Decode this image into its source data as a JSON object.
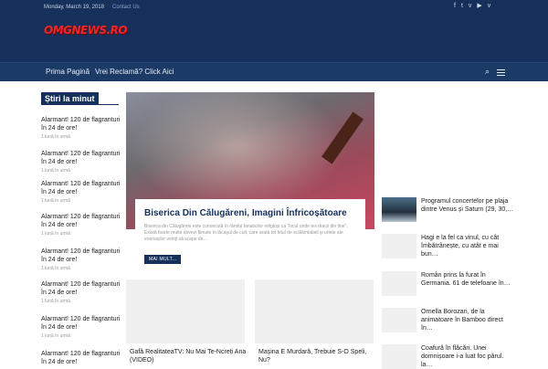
{
  "topbar": {
    "date": "Monday, March 19, 2018",
    "contact": "Contact Us",
    "social_icons": [
      "facebook-icon",
      "twitter-icon",
      "vk-icon",
      "youtube-icon",
      "vimeo-icon"
    ]
  },
  "logo": {
    "text": "OMGNEWS.RO"
  },
  "nav": {
    "items": [
      "Prima Pagină",
      "Vrei Reclamă? Click Aici"
    ]
  },
  "sidebar": {
    "title": "Știri la minut",
    "items": [
      {
        "title": "Alarmant! 120 de flagranturi în 24 de ore!",
        "time": "1 lună în urmă"
      },
      {
        "title": "Alarmant! 120 de flagranturi în 24 de ore!",
        "time": "1 lună în urmă"
      },
      {
        "title": "Alarmant! 120 de flagranturi în 24 de ore!",
        "time": "1 lună în urmă"
      },
      {
        "title": "Alarmant! 120 de flagranturi în 24 de ore!",
        "time": "1 lună în urmă"
      },
      {
        "title": "Alarmant! 120 de flagranturi în 24 de ore!",
        "time": "1 lună în urmă"
      },
      {
        "title": "Alarmant! 120 de flagranturi în 24 de ore!",
        "time": "1 lună în urmă"
      },
      {
        "title": "Alarmant! 120 de flagranturi în 24 de ore!",
        "time": "1 lună în urmă"
      },
      {
        "title": "Alarmant! 120 de flagranturi în 24 de ore!",
        "time": ""
      }
    ]
  },
  "featured": {
    "title": "Biserica Din Călugăreni, Imagini Înfricoșătoare",
    "excerpt": "Biserica din Călugăreni este cunoscută în rândul fanaticilor religioși ca “locul unde ies dracii din tine”. Există foarte multe dovezi filmate în lăcașul de cult, care arată tot felul de scălâmbăieli și urlete ale enoriașilor veniți să scape de…",
    "button": "MAI MULT..."
  },
  "grid": [
    {
      "title": "Gafă RealitateaTV: Nu Mai Te-Ncreți Ana (VIDEO)"
    },
    {
      "title": "Mașina E Murdară, Trebuie S-O Speli, Nu?"
    }
  ],
  "right_list": [
    {
      "title": "Programul concertelor pe plaja dintre Venus și Saturn (29, 30,…"
    },
    {
      "title": "Hagi e la fel ca vinul, cu cât îmbătrânește, cu atât e mai bun…"
    },
    {
      "title": "Român prins la furat în Germania. 61 de telefoane în…"
    },
    {
      "title": "Ornella Borozan, de la animatoare în Bamboo direct în…"
    },
    {
      "title": "Coafură în flăcări. Unei domnișoare i-a luat foc părul. la…"
    }
  ]
}
